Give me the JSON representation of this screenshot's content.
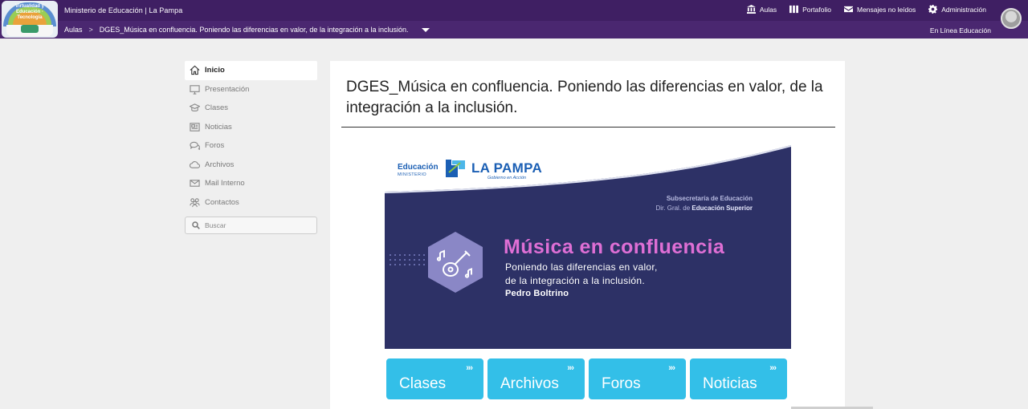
{
  "header": {
    "logo_text": "Virtualidad y Educación · Tecnología",
    "org_name": "Ministerio de Educación | La Pampa",
    "nav": [
      {
        "label": "Aulas",
        "icon": "institution-icon"
      },
      {
        "label": "Portafolio",
        "icon": "portfolio-icon"
      },
      {
        "label": "Mensajes no leídos",
        "icon": "envelope-icon"
      },
      {
        "label": "Administración",
        "icon": "gear-icon"
      }
    ],
    "online_label": "En Línea Educación",
    "colors": {
      "bar": "#4a2770",
      "bar_top": "#3f1f63"
    }
  },
  "breadcrumb": {
    "root": "Aulas",
    "separator": ">",
    "current": "DGES_Música en confluencia. Poniendo las diferencias en valor, de la integración a la inclusión."
  },
  "sidebar": {
    "items": [
      {
        "label": "Inicio",
        "icon": "home-icon",
        "active": true
      },
      {
        "label": "Presentación",
        "icon": "monitor-icon"
      },
      {
        "label": "Clases",
        "icon": "graduation-cap-icon"
      },
      {
        "label": "Noticias",
        "icon": "newspaper-icon"
      },
      {
        "label": "Foros",
        "icon": "chat-bubbles-icon"
      },
      {
        "label": "Archivos",
        "icon": "cloud-icon"
      },
      {
        "label": "Mail Interno",
        "icon": "mail-icon"
      },
      {
        "label": "Contactos",
        "icon": "people-icon"
      }
    ],
    "search_placeholder": "Buscar"
  },
  "main": {
    "title": "DGES_Música en confluencia. Poniendo las diferencias en valor, de la integración a la inclusión.",
    "banner": {
      "educacion": "Educación",
      "ministerio": "MINISTERIO",
      "la_pampa": "LA PAMPA",
      "gobierno": "Gobierno en Acción",
      "subsecretaria": "Subsecretaría de Educación",
      "dir_prefix": "Dir. Gral. de",
      "dir_bold": "Educación Superior",
      "course_title": "Música en confluencia",
      "subtitle_1": "Poniendo las diferencias en valor,",
      "subtitle_2": "de la integración a la inclusión.",
      "author": "Pedro Boltrino",
      "colors": {
        "background": "#2d3166",
        "accent": "#df6fd5",
        "hexagon": "#8a87c6"
      }
    },
    "tiles": [
      {
        "label": "Clases",
        "arrows": "»›"
      },
      {
        "label": "Archivos",
        "arrows": "»›"
      },
      {
        "label": "Foros",
        "arrows": "»›"
      },
      {
        "label": "Noticias",
        "arrows": "»›"
      }
    ],
    "tile_color": "#33bfe8"
  }
}
